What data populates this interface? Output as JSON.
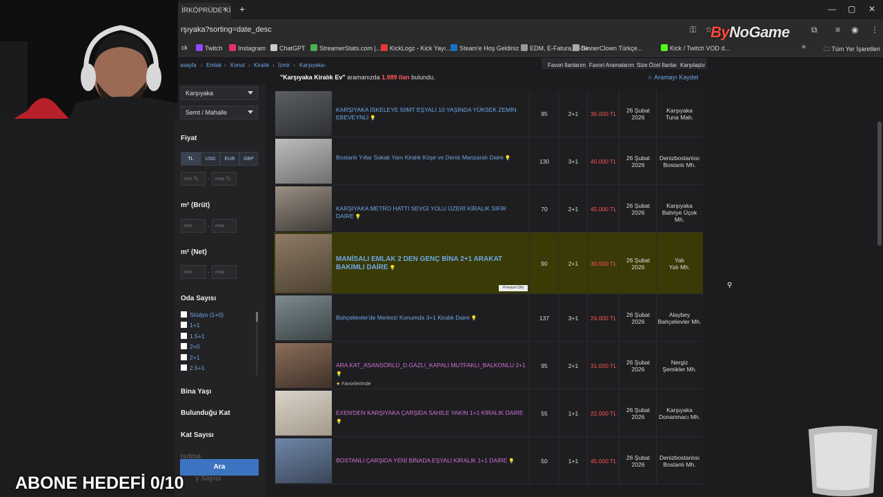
{
  "browser": {
    "tab_title": "İRKÖPRÜDE Kİ",
    "tab_close": "✕",
    "new_tab": "+",
    "url": "rşıyaka?sorting=date_desc",
    "window_controls": [
      "—",
      "▢",
      "✕"
    ]
  },
  "watermark": {
    "part1": "By",
    "part2": "NoGame"
  },
  "bookmarks": [
    {
      "label": "ck",
      "color": "#888888"
    },
    {
      "label": "Twitch",
      "color": "#9146ff"
    },
    {
      "label": "Instagram",
      "color": "#e1306c"
    },
    {
      "label": "ChatGPT",
      "color": "#cccccc"
    },
    {
      "label": "StreamerStats.com |...",
      "color": "#4caf50"
    },
    {
      "label": "KickLogz - Kick Yayı...",
      "color": "#e53935"
    },
    {
      "label": "Steam'e Hoş Geldiniz",
      "color": "#1b6fc2"
    },
    {
      "label": "EDM, E-Fatura, E-De...",
      "color": "#999999"
    },
    {
      "label": "SinnerClown Türkçe...",
      "color": "#aaaaaa"
    },
    {
      "label": "Kick / Twitch VOD d...",
      "color": "#53fc18"
    }
  ],
  "bookmarks_more": "»",
  "all_bookmarks": "Tüm Yer İşaretleri",
  "breadcrumb": [
    "asayfa",
    "Emlak",
    "Konut",
    "Kiralık",
    "İzmir",
    "Karşıyaka"
  ],
  "top_nav": [
    "Favori İlanlarım",
    "Favori Aramalarım",
    "Size Özel İlanlar",
    "Karşılaştır"
  ],
  "search_info": {
    "query": "\"Karşıyaka Kiralık Ev\"",
    "mid": " aramanızda ",
    "count": "1.989 ilan",
    "tail": " bulundu."
  },
  "save_search": "☆ Aramayı Kaydet",
  "sidebar": {
    "district_select": "Karşıyaka",
    "neighborhood_select": "Semt / Mahalle",
    "price_heading": "Fiyat",
    "currencies": [
      "TL",
      "USD",
      "EUR",
      "GBP"
    ],
    "price_min_placeholder": "min TL",
    "price_max_placeholder": "max TL",
    "m2_brut_heading": "m² (Brüt)",
    "m2_net_heading": "m² (Net)",
    "min_placeholder": "min",
    "max_placeholder": "max",
    "dash": "-",
    "rooms_heading": "Oda Sayısı",
    "rooms": [
      "Stüdyo (1+0)",
      "1+1",
      "1.5+1",
      "2+0",
      "2+1",
      "2.5+1"
    ],
    "building_age": "Bina Yaşı",
    "floor": "Bulunduğu Kat",
    "floor_count": "Kat Sayısı",
    "heating_partial": "Isıtma",
    "bathroom_partial": "y Sayısı",
    "search_button": "Ara"
  },
  "listings": [
    {
      "title": "KARŞIYAKA İSKELEYE 50MT EŞYALI 10 YAŞINDA YÜKSEK ZEMİN EBEVEYNLİ",
      "color": "#6fa8e6",
      "m2": "95",
      "rooms": "2+1",
      "price": "36.000 TL",
      "date": "26 Şubat 2026",
      "location": "Karşıyaka Tuna Mah.",
      "premium": false
    },
    {
      "title": "Bostanlı Yıllar Sokak Yanı Kiralık Köşe ve Deniz Manzaralı Daire",
      "color": "#6fa8e6",
      "m2": "130",
      "rooms": "3+1",
      "price": "40.000 TL",
      "date": "26 Şubat 2026",
      "location": "Denizbostanlısı Bostanlı Mh.",
      "premium": false
    },
    {
      "title": "KARŞIYAKA METRO HATTI SEVGİ YOLU ÜZERİ KİRALIK SIFIR DAİRE",
      "color": "#6fa8e6",
      "m2": "70",
      "rooms": "2+1",
      "price": "45.000 TL",
      "date": "26 Şubat 2026",
      "location": "Karşıyaka Bahriye Üçok Mh.",
      "premium": false
    },
    {
      "title": "MANİSALI EMLAK 2 DEN GENÇ BİNA 2+1 ARAKAT BAKIMLI DAİRE",
      "color": "#6fa8e6",
      "m2": "90",
      "rooms": "2+1",
      "price": "30.000 TL",
      "date": "26 Şubat 2026",
      "location": "Yalı Yalı Mh.",
      "premium": true
    },
    {
      "title": "Bahçelievler'de Merkezi Konumda 3+1 Kiralık Daire",
      "color": "#6fa8e6",
      "m2": "137",
      "rooms": "3+1",
      "price": "24.000 TL",
      "date": "26 Şubat 2026",
      "location": "Alaybey Bahçelievler Mh.",
      "premium": false
    },
    {
      "title": "ARA KAT_ASANSÖRLÜ_D.GAZLI_KAPALI MUTFAKLI_BALKONLU 2+1",
      "color": "#d070d8",
      "m2": "95",
      "rooms": "2+1",
      "price": "31.000 TL",
      "date": "26 Şubat 2026",
      "location": "Nergiz Şemikler Mh.",
      "premium": false
    },
    {
      "title": "EXEN'DEN KARŞIYAKA ÇARŞIDA SAHİLE YAKIN 1+1 KİRALIK DAİRE",
      "color": "#d070d8",
      "m2": "55",
      "rooms": "1+1",
      "price": "22.000 TL",
      "date": "26 Şubat 2026",
      "location": "Karşıyaka Donanmacı Mh.",
      "premium": false
    },
    {
      "title": "BOSTANLI ÇARŞIDA YENİ BİNADA EŞYALI KİRALIK 1+1 DAİRE",
      "color": "#d070d8",
      "m2": "50",
      "rooms": "1+1",
      "price": "45.000 TL",
      "date": "26 Şubat 2026",
      "location": "Denizbostanlısı Bostanlı Mh.",
      "premium": false
    }
  ],
  "premium_tag": "Premium Ofis",
  "favorites_tag": "Favorilerimde",
  "stream_overlay": {
    "sub_goal": "ABONE HEDEFİ 0/10"
  }
}
